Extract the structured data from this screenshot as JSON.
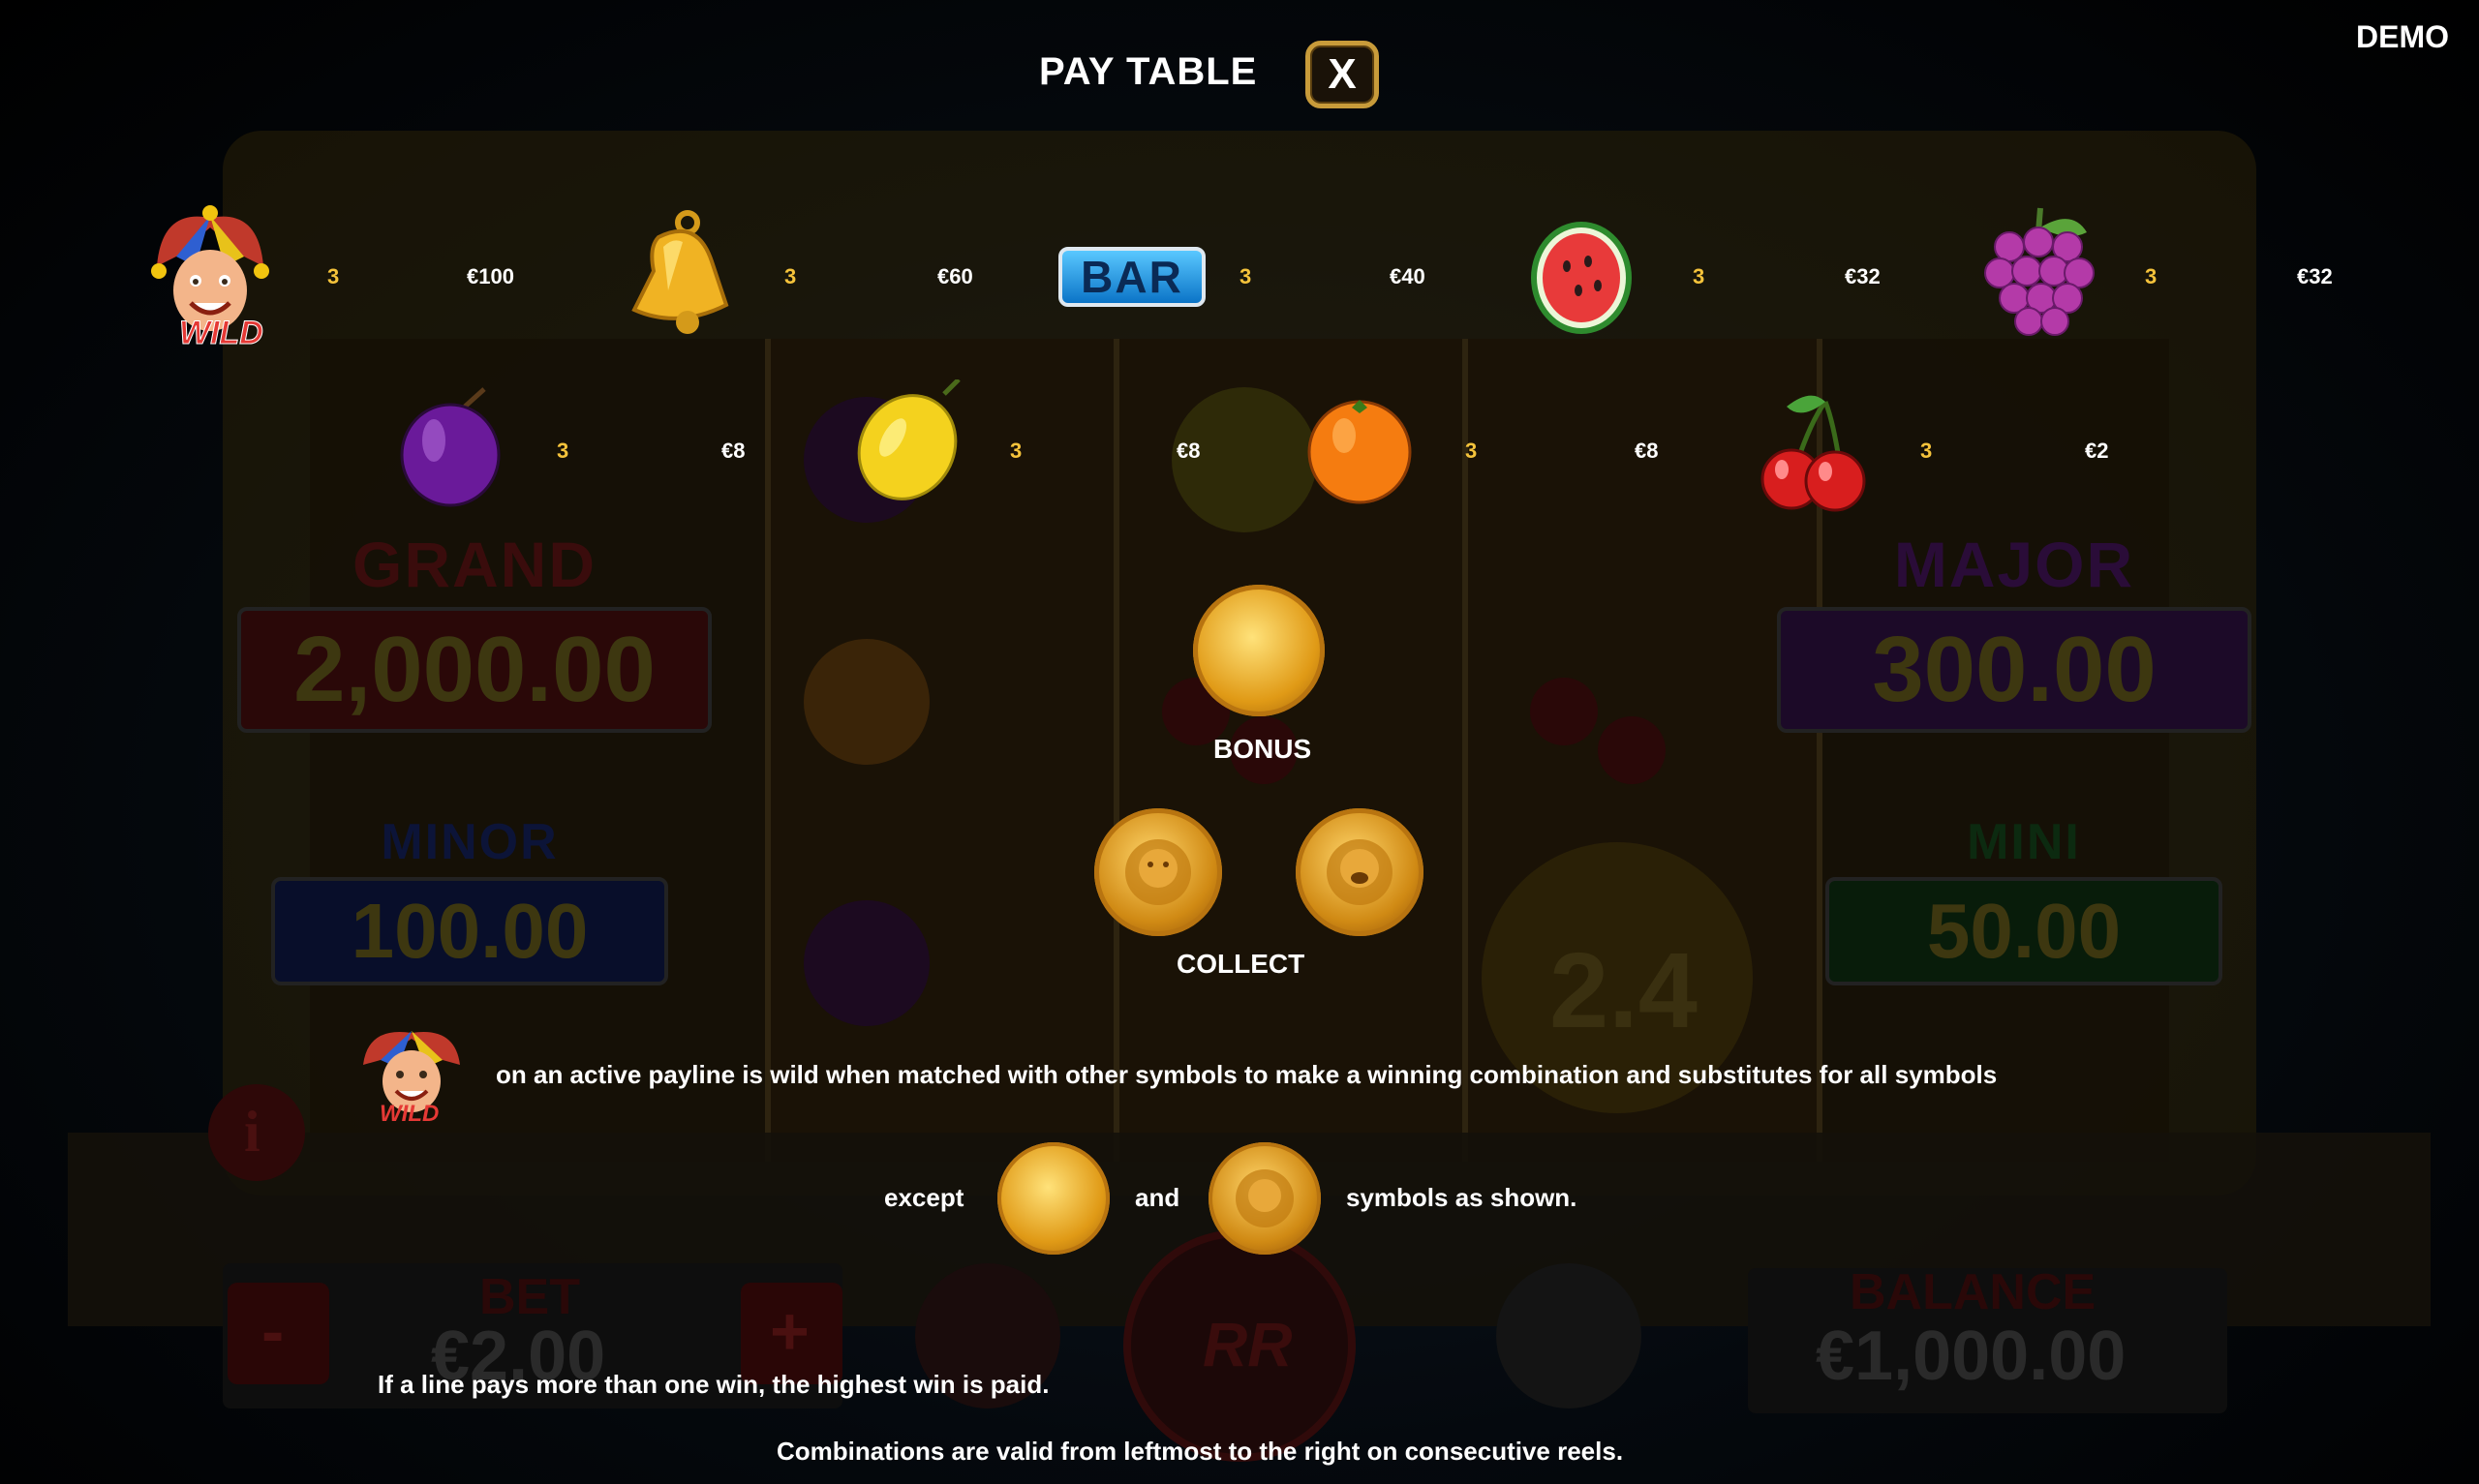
{
  "header": {
    "title": "PAY TABLE",
    "close_label": "X",
    "mode_label": "DEMO"
  },
  "paytable": {
    "row1": [
      {
        "symbol": "wild-jester",
        "count": "3",
        "amount": "€100"
      },
      {
        "symbol": "bell",
        "count": "3",
        "amount": "€60"
      },
      {
        "symbol": "bar",
        "count": "3",
        "amount": "€40"
      },
      {
        "symbol": "watermelon",
        "count": "3",
        "amount": "€32"
      },
      {
        "symbol": "grapes",
        "count": "3",
        "amount": "€32"
      }
    ],
    "row2": [
      {
        "symbol": "plum",
        "count": "3",
        "amount": "€8"
      },
      {
        "symbol": "lemon",
        "count": "3",
        "amount": "€8"
      },
      {
        "symbol": "orange",
        "count": "3",
        "amount": "€8"
      },
      {
        "symbol": "cherry",
        "count": "3",
        "amount": "€2"
      }
    ],
    "bar_label": "BAR",
    "wild_label": "WILD"
  },
  "special": {
    "bonus_label": "BONUS",
    "collect_label": "COLLECT"
  },
  "rules": {
    "wild_text": "on an active payline is wild when matched with other symbols to make a winning combination and substitutes for all symbols",
    "except_label": "except",
    "and_label": "and",
    "shown_label": "symbols as shown.",
    "highest_win": "If a line pays more than one win, the highest win is paid.",
    "combinations": "Combinations are valid from leftmost to the right on consecutive reels."
  },
  "background": {
    "grand_title": "GRAND",
    "grand_value": "2,000.00",
    "major_title": "MAJOR",
    "major_value": "300.00",
    "minor_title": "MINOR",
    "minor_value": "100.00",
    "mini_title": "MINI",
    "mini_value": "50.00",
    "bet_title": "BET",
    "bet_value": "€2.00",
    "balance_title": "BALANCE",
    "balance_value": "€1,000.00",
    "coin_value": "2.4",
    "info_label": "i",
    "minus_label": "-",
    "plus_label": "+",
    "spin_logo": "RR"
  },
  "colors": {
    "accent_gold": "#f5c33b",
    "frame_gold": "#c89b3a",
    "grand": "#5a1010",
    "major": "#3a1450",
    "minor": "#0e1a55",
    "mini": "#0e3a14"
  }
}
